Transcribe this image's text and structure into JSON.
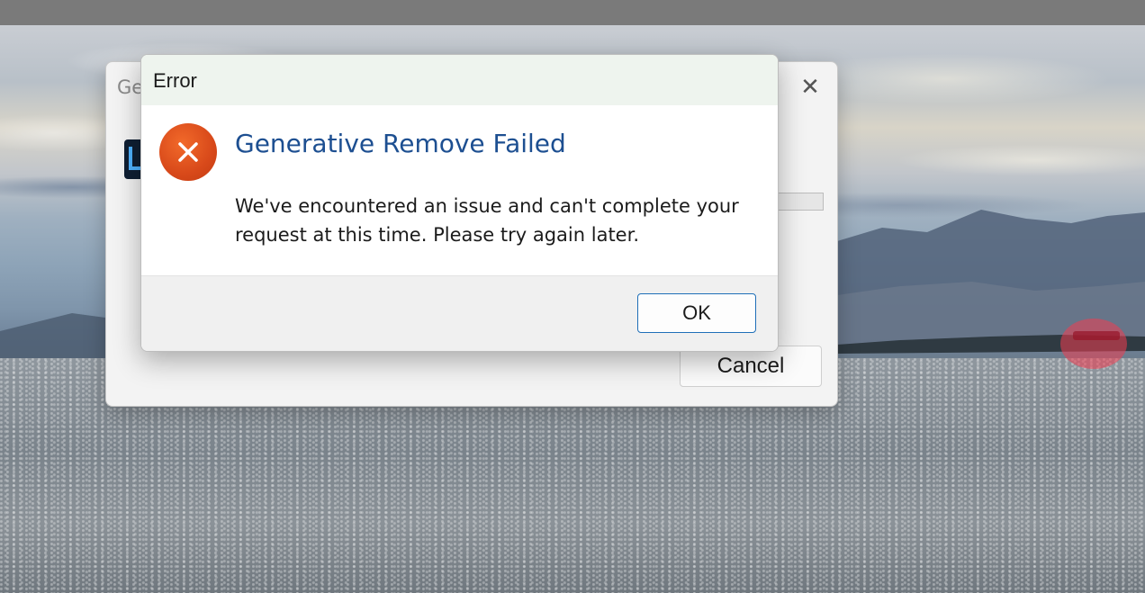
{
  "background": {
    "photo_name": "seascape-photo",
    "top_bar_color": "#7a7a7a"
  },
  "back_dialog": {
    "title": "Ge",
    "close_icon": "close-icon",
    "close_glyph": "✕",
    "cancel_label": "Cancel"
  },
  "error_dialog": {
    "title": "Error",
    "icon": "error-icon",
    "icon_color": "#d8491a",
    "heading": "Generative Remove Failed",
    "heading_color": "#1d4f91",
    "message": "We've encountered an issue and can't complete your request at this time. Please try again later.",
    "ok_label": "OK"
  }
}
